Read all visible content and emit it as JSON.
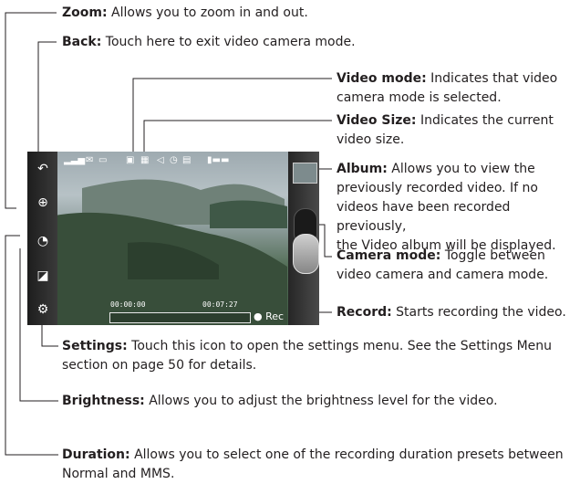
{
  "callouts": {
    "zoom": {
      "title": "Zoom:",
      "desc": "Allows you to zoom in and out."
    },
    "back": {
      "title": "Back:",
      "desc": "Touch here to exit video camera mode."
    },
    "video_mode": {
      "title": "Video mode:",
      "desc_1": "Indicates that video",
      "desc_2": "camera mode is selected."
    },
    "video_size": {
      "title": "Video Size:",
      "desc_1": "Indicates the current",
      "desc_2": "video size."
    },
    "album": {
      "title": "Album:",
      "desc_1": "Allows you to view the",
      "desc_2": "previously recorded video. If no",
      "desc_3": "videos have been recorded previously,",
      "desc_4": "the Video album will be displayed."
    },
    "camera_mode": {
      "title": "Camera mode:",
      "desc_1": "Toggle between",
      "desc_2": "video camera and camera mode."
    },
    "record": {
      "title": "Record:",
      "desc": "Starts recording the video."
    },
    "settings": {
      "title": "Settings:",
      "desc_1": "Touch this icon to open the settings menu. See the Settings Menu",
      "desc_2": "section on page 50 for details."
    },
    "brightness": {
      "title": "Brightness:",
      "desc": "Allows you to adjust the brightness level for the video."
    },
    "duration": {
      "title": "Duration:",
      "desc_1": "Allows you to select one of the recording duration presets between",
      "desc_2": "Normal and MMS."
    }
  },
  "screen": {
    "elapsed": "00:00:00",
    "remaining": "00:07:27",
    "rec_label": "Rec"
  }
}
